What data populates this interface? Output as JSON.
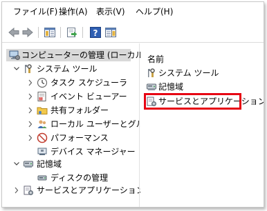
{
  "menu": [
    "ファイル(F)",
    "操作(A)",
    "表示(V)",
    "ヘルプ(H)"
  ],
  "tree": {
    "root": "コンピューターの管理 (ローカル)",
    "system_tools": "システム ツール",
    "task_scheduler": "タスク スケジューラ",
    "event_viewer": "イベント ビューアー",
    "shared_folders": "共有フォルダー",
    "local_users": "ローカル ユーザーとグループ",
    "performance": "パフォーマンス",
    "device_manager": "デバイス マネージャー",
    "storage": "記憶域",
    "disk_management": "ディスクの管理",
    "services_apps": "サービスとアプリケーション"
  },
  "right": {
    "header": "名前",
    "items": [
      "システム ツール",
      "記憶域",
      "サービスとアプリケーション"
    ]
  },
  "colors": {
    "highlight": "#e60012",
    "selection": "#d9d9d9"
  }
}
